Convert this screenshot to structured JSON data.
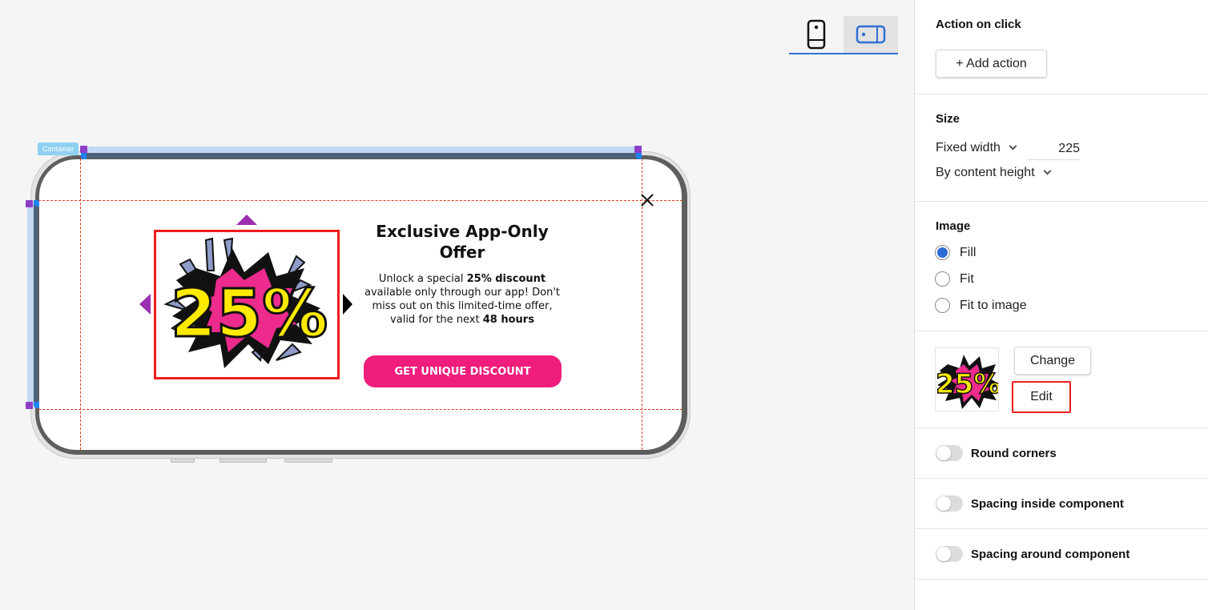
{
  "canvas": {
    "device_toggle": {
      "options": [
        {
          "name": "portrait",
          "icon": "phone-portrait-icon",
          "active": false
        },
        {
          "name": "landscape",
          "icon": "phone-landscape-icon",
          "active": true
        }
      ]
    },
    "container_label": "Container",
    "popup": {
      "close_icon": "close-icon",
      "image_alt": "25% comic burst",
      "image_text": "25%",
      "title": "Exclusive App-Only Offer",
      "body_prefix": "Unlock a special ",
      "body_bold_1": "25% discount",
      "body_middle": " available only through our app! Don't miss out on this limited-time offer, valid for the next ",
      "body_bold_2": "48 hours",
      "cta_label": "GET UNIQUE DISCOUNT"
    },
    "colors": {
      "cta": "#f01d7c",
      "selection": "#ee1c1c",
      "handle": "#8e3fc9",
      "accent": "#2f6fd6"
    }
  },
  "panel": {
    "action": {
      "title": "Action on click",
      "add_action_label": "+ Add action"
    },
    "size": {
      "title": "Size",
      "width_mode": "Fixed width",
      "width_value": "225",
      "height_mode": "By content height"
    },
    "image": {
      "title": "Image",
      "options": [
        {
          "label": "Fill",
          "selected": true
        },
        {
          "label": "Fit",
          "selected": false
        },
        {
          "label": "Fit to image",
          "selected": false
        }
      ]
    },
    "image_actions": {
      "change_label": "Change",
      "edit_label": "Edit"
    },
    "toggles": [
      {
        "label": "Round corners",
        "on": false
      },
      {
        "label": "Spacing inside component",
        "on": false
      },
      {
        "label": "Spacing around component",
        "on": false
      }
    ]
  }
}
